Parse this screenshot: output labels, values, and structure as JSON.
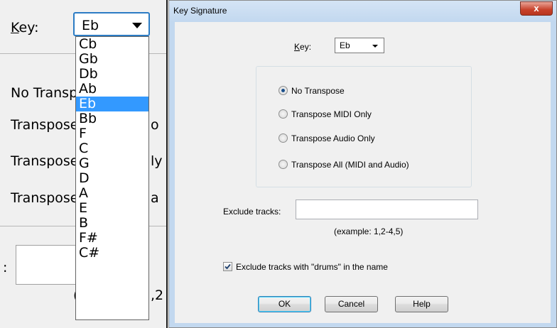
{
  "zoom": {
    "key_label": "Key:",
    "key_value": "Eb",
    "bg_texts": [
      "No Transp",
      "Transpose",
      "Transpose",
      "Transpose"
    ],
    "bg_right": [
      "o",
      "ly",
      "a"
    ],
    "colon": ":",
    "paren": "(",
    "paren_right": ",2",
    "options": [
      "Cb",
      "Gb",
      "Db",
      "Ab",
      "Eb",
      "Bb",
      "F",
      "C",
      "G",
      "D",
      "A",
      "E",
      "B",
      "F#",
      "C#"
    ],
    "selected": "Eb"
  },
  "dialog": {
    "title": "Key Signature",
    "close_glyph": "x",
    "key_label": "Key:",
    "key_value": "Eb",
    "radios": [
      {
        "label": "No Transpose",
        "checked": true
      },
      {
        "label": "Transpose MIDI Only",
        "checked": false
      },
      {
        "label": "Transpose Audio Only",
        "checked": false
      },
      {
        "label": "Transpose All (MIDI and Audio)",
        "checked": false
      }
    ],
    "exclude_label": "Exclude tracks:",
    "exclude_value": "",
    "example": "(example: 1,2-4,5)",
    "drums_label": "Exclude tracks with \"drums\" in the name",
    "drums_checked": true,
    "buttons": {
      "ok": "OK",
      "cancel": "Cancel",
      "help": "Help"
    }
  }
}
